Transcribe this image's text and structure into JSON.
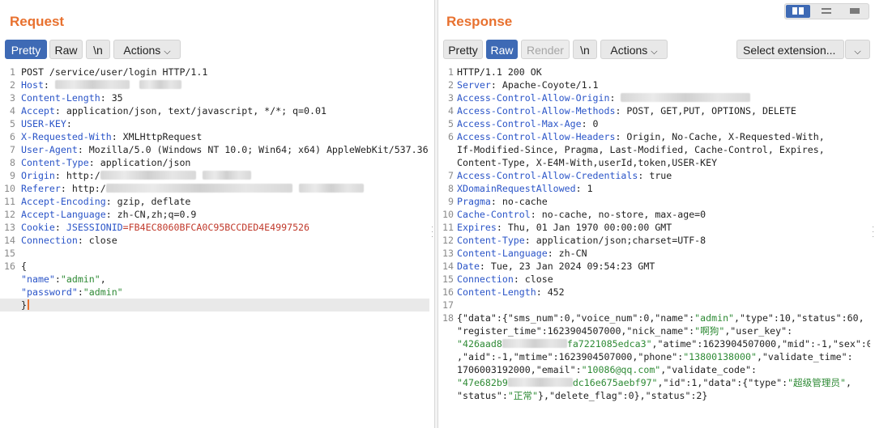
{
  "request": {
    "title": "Request",
    "tabs": [
      {
        "label": "Pretty",
        "active": true
      },
      {
        "label": "Raw",
        "active": false
      },
      {
        "label": "\\n",
        "active": false
      },
      {
        "label": "Actions",
        "active": false
      }
    ],
    "lines": [
      {
        "n": "1",
        "text": "POST /service/user/login HTTP/1.1"
      },
      {
        "n": "2",
        "name": "Host",
        "value": ""
      },
      {
        "n": "3",
        "name": "Content-Length",
        "value": "35"
      },
      {
        "n": "4",
        "name": "Accept",
        "value": "application/json, text/javascript, */*; q=0.01"
      },
      {
        "n": "5",
        "name": "USER-KEY",
        "value": ""
      },
      {
        "n": "6",
        "name": "X-Requested-With",
        "value": "XMLHttpRequest"
      },
      {
        "n": "7",
        "name": "User-Agent",
        "value": "Mozilla/5.0 (Windows NT 10.0; Win64; x64) AppleWebKit/537.36"
      },
      {
        "n": "8",
        "name": "Content-Type",
        "value": "application/json"
      },
      {
        "n": "9",
        "name": "Origin",
        "value": "http:/"
      },
      {
        "n": "10",
        "name": "Referer",
        "value": "http:/"
      },
      {
        "n": "11",
        "name": "Accept-Encoding",
        "value": "gzip, deflate"
      },
      {
        "n": "12",
        "name": "Accept-Language",
        "value": "zh-CN,zh;q=0.9"
      },
      {
        "n": "13",
        "name": "Cookie",
        "cookie_name": "JSESSIONID",
        "cookie_value": "=FB4EC8060BFCA0C95BCCDED4E4997526"
      },
      {
        "n": "14",
        "name": "Connection",
        "value": "close"
      },
      {
        "n": "15",
        "text": ""
      },
      {
        "n": "16",
        "text": "{"
      },
      {
        "n": "",
        "key": "\"name\"",
        "val": "\"admin\"",
        "tail": ","
      },
      {
        "n": "",
        "key": "\"password\"",
        "val": "\"admin\"",
        "tail": ""
      },
      {
        "n": "",
        "text": "}"
      }
    ]
  },
  "response": {
    "title": "Response",
    "tabs": [
      {
        "label": "Pretty",
        "active": false
      },
      {
        "label": "Raw",
        "active": true
      },
      {
        "label": "Render",
        "active": false,
        "disabled": true
      },
      {
        "label": "\\n",
        "active": false
      },
      {
        "label": "Actions",
        "active": false
      }
    ],
    "extension_select": "Select extension...",
    "lines": [
      {
        "n": "1",
        "text": "HTTP/1.1 200 OK"
      },
      {
        "n": "2",
        "name": "Server",
        "value": "Apache-Coyote/1.1"
      },
      {
        "n": "3",
        "name": "Access-Control-Allow-Origin",
        "value": ""
      },
      {
        "n": "4",
        "name": "Access-Control-Allow-Methods",
        "value": "POST, GET,PUT, OPTIONS, DELETE"
      },
      {
        "n": "5",
        "name": "Access-Control-Max-Age",
        "value": "0"
      },
      {
        "n": "6",
        "name": "Access-Control-Allow-Headers",
        "value": "Origin, No-Cache, X-Requested-With,"
      },
      {
        "n": "",
        "text": "If-Modified-Since, Pragma, Last-Modified, Cache-Control, Expires,"
      },
      {
        "n": "",
        "text": "Content-Type, X-E4M-With,userId,token,USER-KEY"
      },
      {
        "n": "7",
        "name": "Access-Control-Allow-Credentials",
        "value": "true"
      },
      {
        "n": "8",
        "name": "XDomainRequestAllowed",
        "value": "1"
      },
      {
        "n": "9",
        "name": "Pragma",
        "value": "no-cache"
      },
      {
        "n": "10",
        "name": "Cache-Control",
        "value": "no-cache, no-store, max-age=0"
      },
      {
        "n": "11",
        "name": "Expires",
        "value": "Thu, 01 Jan 1970 00:00:00 GMT"
      },
      {
        "n": "12",
        "name": "Content-Type",
        "value": "application/json;charset=UTF-8"
      },
      {
        "n": "13",
        "name": "Content-Language",
        "value": "zh-CN"
      },
      {
        "n": "14",
        "name": "Date",
        "value": "Tue, 23 Jan 2024 09:54:23 GMT"
      },
      {
        "n": "15",
        "name": "Connection",
        "value": "close"
      },
      {
        "n": "16",
        "name": "Content-Length",
        "value": "452"
      },
      {
        "n": "17",
        "text": ""
      },
      {
        "n": "18",
        "parts": [
          [
            "t",
            "{\"data\":{\"sms_num\":0,\"voice_num\":0,\"name\":"
          ],
          [
            "s",
            "\"admin\""
          ],
          [
            "t",
            ",\"type\":10,\"status\":60,"
          ]
        ]
      },
      {
        "n": "",
        "parts": [
          [
            "t",
            "\"register_time\":1623904507000,\"nick_name\":"
          ],
          [
            "s",
            "\"啊狗\""
          ],
          [
            "t",
            ",\"user_key\":"
          ]
        ]
      },
      {
        "n": "",
        "parts": [
          [
            "s",
            "\"426aad8"
          ],
          [
            "b",
            ""
          ],
          [
            "s",
            "fa7221085edca3\""
          ],
          [
            "t",
            ",\"atime\":1623904507000,\"mid\":-1,\"sex\":0"
          ]
        ]
      },
      {
        "n": "",
        "parts": [
          [
            "t",
            ",\"aid\":-1,\"mtime\":1623904507000,\"phone\":"
          ],
          [
            "s",
            "\"13800138000\""
          ],
          [
            "t",
            ",\"validate_time\":"
          ]
        ]
      },
      {
        "n": "",
        "parts": [
          [
            "t",
            "1706003192000,\"email\":"
          ],
          [
            "s",
            "\"10086@qq.com\""
          ],
          [
            "t",
            ",\"validate_code\":"
          ]
        ]
      },
      {
        "n": "",
        "parts": [
          [
            "s",
            "\"47e682b9"
          ],
          [
            "b",
            ""
          ],
          [
            "s",
            "dc16e675aebf97\""
          ],
          [
            "t",
            ",\"id\":1,\"data\":{\"type\":"
          ],
          [
            "s",
            "\"超级管理员\""
          ],
          [
            "t",
            ","
          ]
        ]
      },
      {
        "n": "",
        "parts": [
          [
            "t",
            "\"status\":"
          ],
          [
            "s",
            "\"正常\""
          ],
          [
            "t",
            "},\"delete_flag\":0},\"status\":2}"
          ]
        ]
      }
    ]
  }
}
